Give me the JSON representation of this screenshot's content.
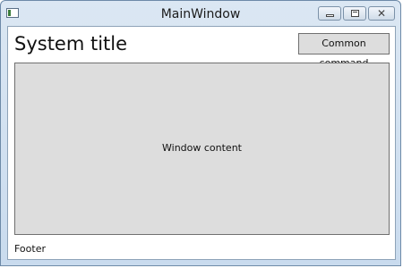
{
  "window": {
    "title": "MainWindow",
    "close_glyph": "✕"
  },
  "header": {
    "system_title": "System title",
    "common_command_label": "Common command"
  },
  "content": {
    "label": "Window content"
  },
  "footer": {
    "text": "Footer"
  },
  "colors": {
    "content_background": "#dddddd",
    "button_background": "#dddddd",
    "frame": "#c9dbee"
  },
  "icons": {
    "app": "app-window-icon",
    "minimize": "minimize-icon",
    "maximize": "maximize-icon",
    "close": "close-icon"
  }
}
